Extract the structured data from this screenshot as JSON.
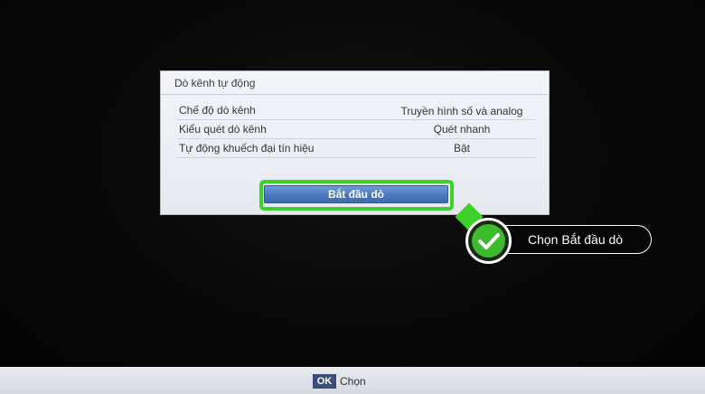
{
  "dialog": {
    "title": "Dò kênh tự động",
    "rows": [
      {
        "label": "Chế độ dò kênh",
        "value": "Truyền hình số và analog"
      },
      {
        "label": "Kiểu quét dò kênh",
        "value": "Quét nhanh"
      },
      {
        "label": "Tự động khuếch đại tín hiệu",
        "value": "Bật"
      }
    ],
    "start_button": "Bắt đầu dò"
  },
  "callout": {
    "text": "Chọn Bắt đầu dò",
    "icon": "check-icon",
    "color": "#3ed12c"
  },
  "footer": {
    "key": "OK",
    "label": "Chọn"
  }
}
